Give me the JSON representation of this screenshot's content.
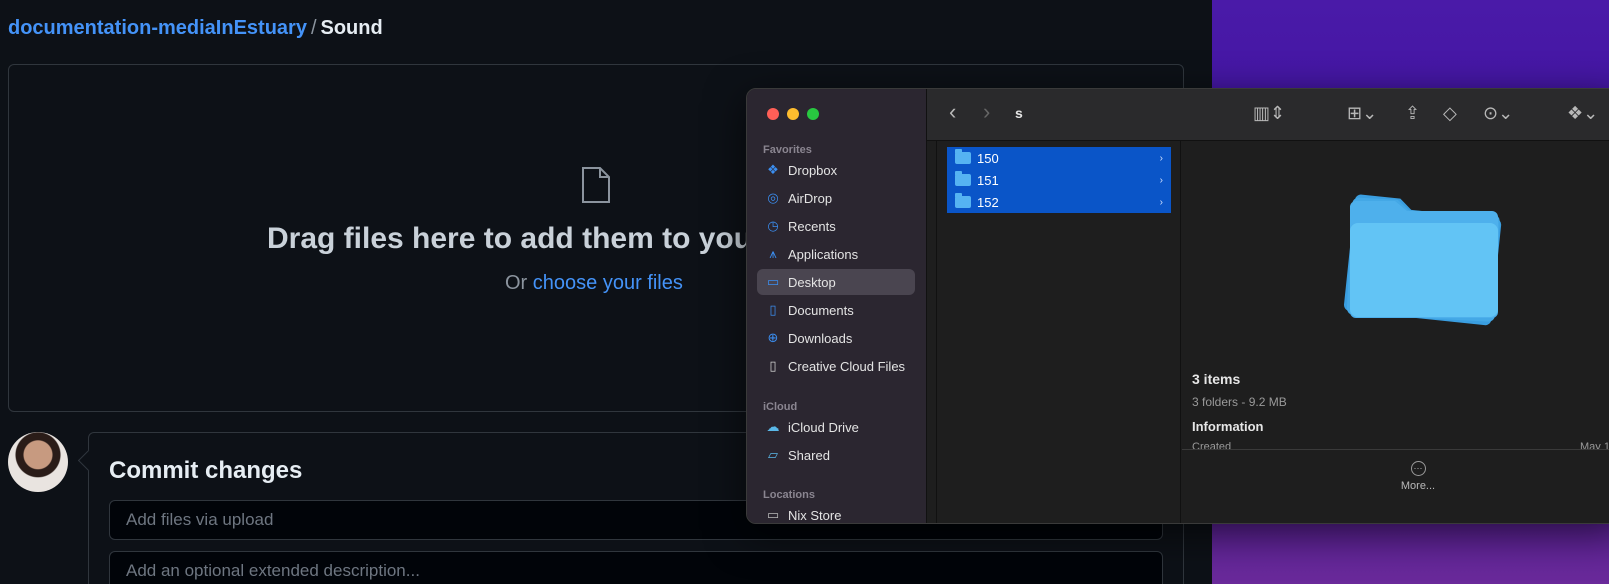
{
  "github": {
    "breadcrumb": {
      "repo": "documentation-mediaInEstuary",
      "separator": "/",
      "current": "Sound"
    },
    "dropzone": {
      "title": "Drag files here to add them to you",
      "or_text": "Or",
      "choose_link": "choose your files"
    },
    "commit": {
      "title": "Commit changes",
      "summary_placeholder": "Add files via upload",
      "description_placeholder": "Add an optional extended description..."
    }
  },
  "finder": {
    "path_title": "s",
    "sidebar": {
      "favorites_label": "Favorites",
      "favorites": [
        {
          "label": "Dropbox",
          "icon": "dropbox-icon"
        },
        {
          "label": "AirDrop",
          "icon": "airdrop-icon"
        },
        {
          "label": "Recents",
          "icon": "clock-icon"
        },
        {
          "label": "Applications",
          "icon": "applications-icon"
        },
        {
          "label": "Desktop",
          "icon": "desktop-icon",
          "active": true
        },
        {
          "label": "Documents",
          "icon": "document-icon"
        },
        {
          "label": "Downloads",
          "icon": "download-icon"
        },
        {
          "label": "Creative Cloud Files",
          "icon": "file-icon"
        }
      ],
      "icloud_label": "iCloud",
      "icloud": [
        {
          "label": "iCloud Drive",
          "icon": "cloud-icon"
        },
        {
          "label": "Shared",
          "icon": "shared-folder-icon"
        }
      ],
      "locations_label": "Locations",
      "locations": [
        {
          "label": "Nix Store",
          "icon": "drive-icon"
        }
      ]
    },
    "folders": [
      "150",
      "151",
      "152"
    ],
    "preview": {
      "items": "3 items",
      "summary": "3 folders - 9.2 MB",
      "information": "Information",
      "created": "Created",
      "created_value": "May 1",
      "more": "More..."
    }
  },
  "colors": {
    "accent_link": "#4493f8",
    "selection": "#0a55c8",
    "folder": "#55b3f2"
  }
}
